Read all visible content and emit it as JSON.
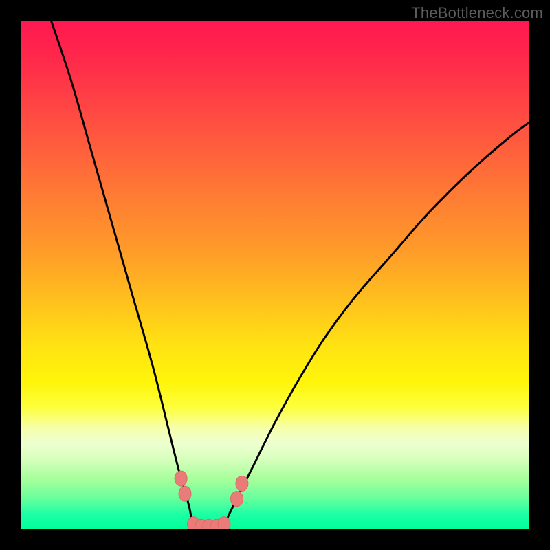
{
  "watermark": {
    "text": "TheBottleneck.com"
  },
  "palette": {
    "background": "#000000",
    "curve": "#000000",
    "marker_fill": "#e97c78",
    "marker_stroke": "#d86b67",
    "gradient_top": "#ff1850",
    "gradient_mid": "#fff50a",
    "gradient_bottom": "#00ff99"
  },
  "chart_data": {
    "type": "line",
    "title": "",
    "xlabel": "",
    "ylabel": "",
    "xlim": [
      0,
      100
    ],
    "ylim": [
      0,
      100
    ],
    "grid": false,
    "legend_position": "none",
    "note": "Axis values are relative (0–100); no numeric ticks are shown in the source image. The curve is a V-shaped bottleneck profile with a flat minimum near x≈34–40.",
    "series": [
      {
        "name": "bottleneck-curve",
        "x": [
          6,
          10,
          14,
          18,
          22,
          26,
          29,
          31,
          33,
          34,
          36,
          38,
          40,
          41,
          43,
          46,
          50,
          55,
          60,
          66,
          73,
          80,
          88,
          96,
          100
        ],
        "y": [
          100,
          88,
          74,
          60,
          46,
          32,
          20,
          12,
          5,
          1,
          0,
          0,
          1,
          3,
          7,
          13,
          21,
          30,
          38,
          46,
          54,
          62,
          70,
          77,
          80
        ]
      }
    ],
    "markers": [
      {
        "name": "left-cluster-upper",
        "x": 31.5,
        "y": 10
      },
      {
        "name": "left-cluster-lower",
        "x": 32.3,
        "y": 7
      },
      {
        "name": "floor-1",
        "x": 34.0,
        "y": 1
      },
      {
        "name": "floor-2",
        "x": 35.5,
        "y": 0.5
      },
      {
        "name": "floor-3",
        "x": 37.0,
        "y": 0.5
      },
      {
        "name": "floor-4",
        "x": 38.5,
        "y": 0.5
      },
      {
        "name": "floor-5",
        "x": 40.0,
        "y": 1
      },
      {
        "name": "right-cluster-lower",
        "x": 42.5,
        "y": 6
      },
      {
        "name": "right-cluster-upper",
        "x": 43.5,
        "y": 9
      }
    ]
  }
}
